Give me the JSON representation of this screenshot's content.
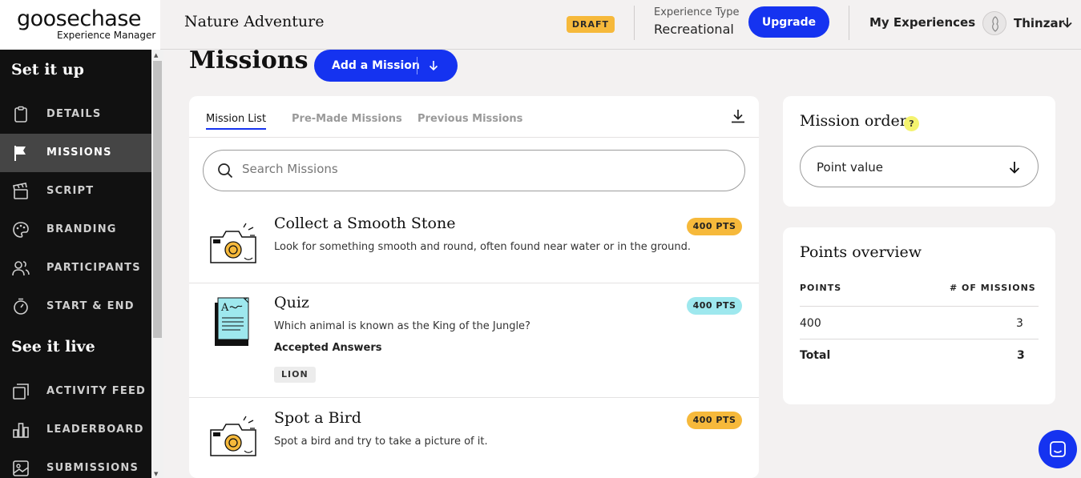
{
  "header": {
    "logo": "goosechase",
    "logo_sub": "Experience Manager",
    "experience_title": "Nature Adventure",
    "status_badge": "DRAFT",
    "experience_type_label": "Experience Type",
    "experience_type_value": "Recreational",
    "upgrade_label": "Upgrade",
    "my_experiences_label": "My Experiences",
    "user_name": "Thinzar"
  },
  "sidebar": {
    "section_setup": "Set it up",
    "section_live": "See it live",
    "setup_items": [
      {
        "label": "DETAILS",
        "icon": "clipboard-icon"
      },
      {
        "label": "MISSIONS",
        "icon": "flag-icon",
        "active": true
      },
      {
        "label": "SCRIPT",
        "icon": "clapperboard-icon"
      },
      {
        "label": "BRANDING",
        "icon": "palette-icon"
      },
      {
        "label": "PARTICIPANTS",
        "icon": "people-icon"
      },
      {
        "label": "START & END",
        "icon": "stopwatch-icon"
      }
    ],
    "live_items": [
      {
        "label": "ACTIVITY FEED",
        "icon": "feed-icon"
      },
      {
        "label": "LEADERBOARD",
        "icon": "bar-chart-icon"
      },
      {
        "label": "SUBMISSIONS",
        "icon": "image-icon"
      }
    ]
  },
  "main": {
    "title": "Missions",
    "add_mission_label": "Add a Mission",
    "tabs": [
      "Mission List",
      "Pre-Made Missions",
      "Previous Missions"
    ],
    "search_placeholder": "Search Missions",
    "missions": [
      {
        "title": "Collect a Smooth Stone",
        "description": "Look for something smooth and round, often found near water or in the ground.",
        "points": "400 PTS",
        "type": "photo"
      },
      {
        "title": "Quiz",
        "description": "Which animal is known as the King of the Jungle?",
        "points": "400 PTS",
        "type": "text",
        "accepted_answers_label": "Accepted Answers",
        "answers": [
          "LION"
        ]
      },
      {
        "title": "Spot a Bird",
        "description": "Spot a bird and try to take a picture of it.",
        "points": "400 PTS",
        "type": "photo"
      }
    ]
  },
  "mission_order": {
    "title": "Mission order",
    "help": "?",
    "selected": "Point value"
  },
  "points_overview": {
    "title": "Points overview",
    "columns": [
      "POINTS",
      "# OF MISSIONS"
    ],
    "rows": [
      {
        "points": "400",
        "count": "3"
      }
    ],
    "total_label": "Total",
    "total_value": "3"
  },
  "colors": {
    "accent": "#1533f0",
    "gold_badge": "#f6b93b",
    "aqua_badge": "#9ee8ee",
    "sidebar_bg": "#111111",
    "sidebar_active": "#454545"
  }
}
